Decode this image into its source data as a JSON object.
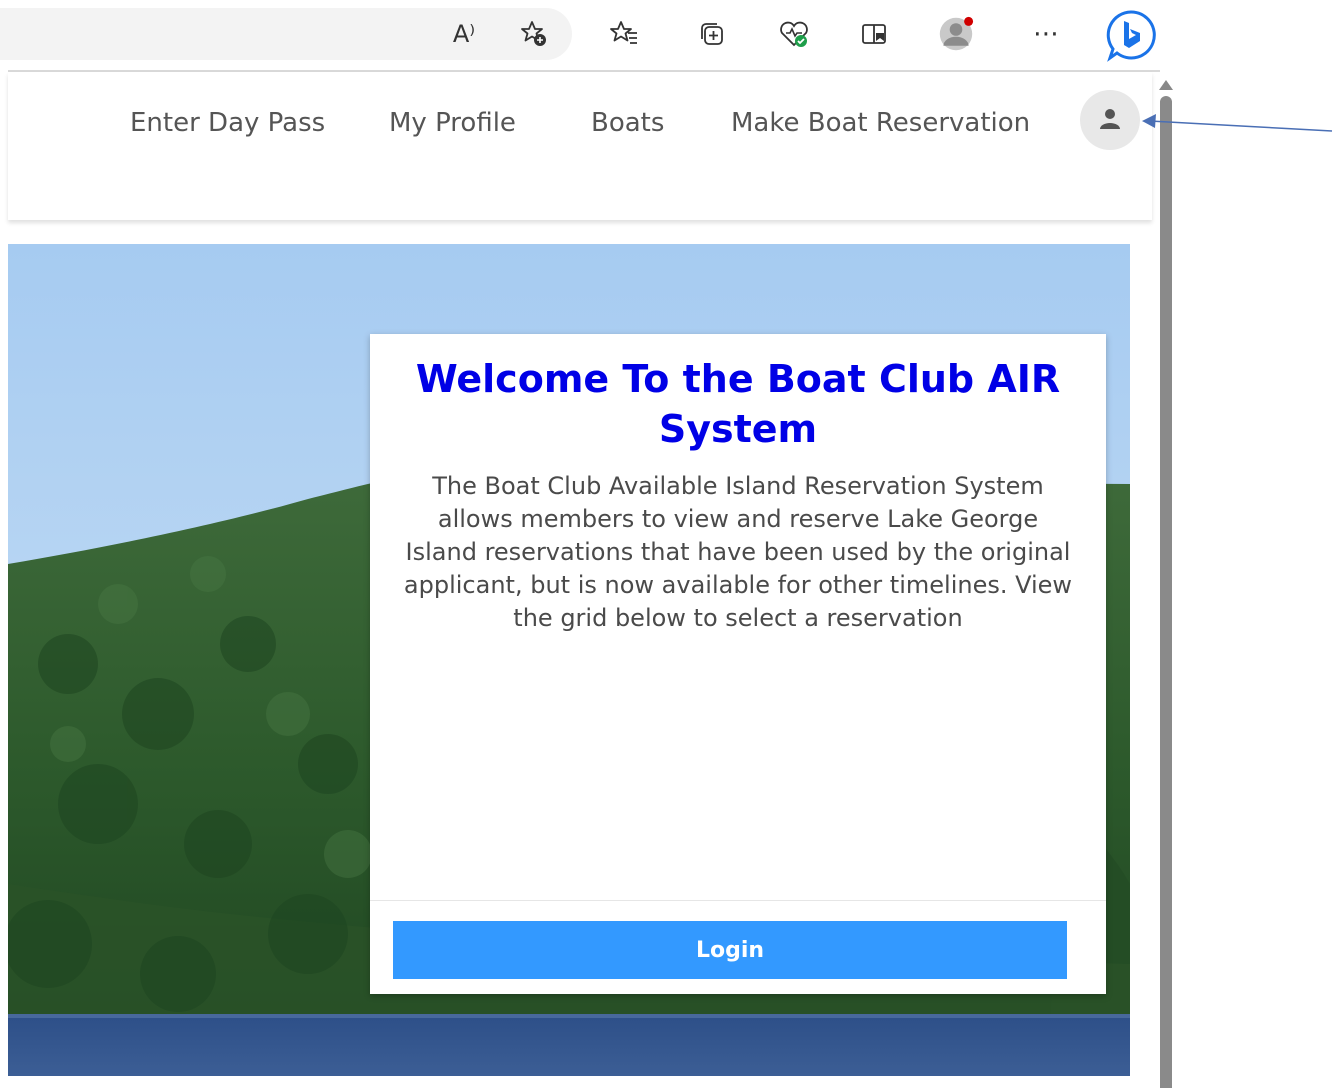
{
  "browser": {
    "toolbar_icons": [
      {
        "name": "read-aloud-icon",
        "glyph": "A⁾"
      },
      {
        "name": "add-favorite-icon"
      },
      {
        "name": "favorites-icon"
      },
      {
        "name": "collections-icon"
      },
      {
        "name": "browser-essentials-icon"
      },
      {
        "name": "immersive-reader-icon"
      },
      {
        "name": "profile-avatar-icon"
      },
      {
        "name": "more-options-icon",
        "glyph": "⋯"
      },
      {
        "name": "bing-copilot-icon"
      }
    ]
  },
  "nav": {
    "links": [
      "Enter Day Pass",
      "My Profile",
      "Boats",
      "Make Boat Reservation"
    ],
    "user_icon": "user-icon"
  },
  "welcome": {
    "title": "Welcome To the Boat Club AIR System",
    "body": "The Boat Club Available Island Reservation System allows members to view and reserve Lake George Island reservations that have been used by the original applicant, but is now available for other timelines.  View the grid below to select a reservation",
    "login_label": "Login"
  },
  "colors": {
    "title_blue": "#0000e6",
    "login_button": "#3399ff",
    "annotation_arrow": "#4a6fb5"
  }
}
